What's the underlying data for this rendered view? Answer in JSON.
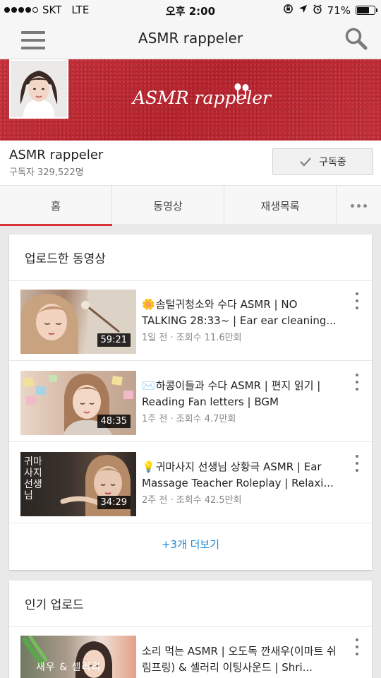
{
  "status_bar": {
    "carrier": "SKT",
    "network": "LTE",
    "time": "오후 2:00",
    "battery_text": "71%",
    "battery_level": 0.71
  },
  "app_bar": {
    "title": "ASMR rappeler",
    "menu_icon": "hamburger-menu-icon",
    "search_icon": "search-icon"
  },
  "banner": {
    "logo_text": "ASMR rappeler",
    "background_color": "#c0272f"
  },
  "channel": {
    "name": "ASMR rappeler",
    "subscribers": "구독자 329,522명",
    "subscribe_label": "구독중"
  },
  "tabs": [
    {
      "label": "홈",
      "active": true
    },
    {
      "label": "동영상",
      "active": false
    },
    {
      "label": "재생목록",
      "active": false
    }
  ],
  "uploads": {
    "title": "업로드한 동영상",
    "videos": [
      {
        "icon": "🌼",
        "title": "솜털귀청소와 수다 ASMR | NO TALKING 28:33~ | Ear ear cleaning...",
        "meta": "1일 전 · 조회수 11.6만회",
        "duration": "59:21"
      },
      {
        "icon": "✉️",
        "title": "하콩이들과 수다 ASMR | 편지 읽기 | Reading Fan letters | BGM",
        "meta": "1주 전 · 조회수 4.7만회",
        "duration": "48:35"
      },
      {
        "icon": "💡",
        "title": "귀마사지 선생님 상황극 ASMR | Ear Massage Teacher Roleplay | Relaxi...",
        "meta": "2주 전 · 조회수 42.5만회",
        "duration": "34:29",
        "thumb_overlay_text": "귀마사지 선생님"
      }
    ],
    "show_more": "+3개 더보기"
  },
  "popular": {
    "title": "인기 업로드",
    "videos": [
      {
        "title": "소리 먹는 ASMR | 오도독 깐새우(이마트 쉬림프링) & 셀러리 이팅사운드 | Shri...",
        "thumb_overlay_text": "새우 & 셀러리"
      }
    ]
  },
  "colors": {
    "accent": "#d8333a",
    "link": "#1e88d6"
  }
}
